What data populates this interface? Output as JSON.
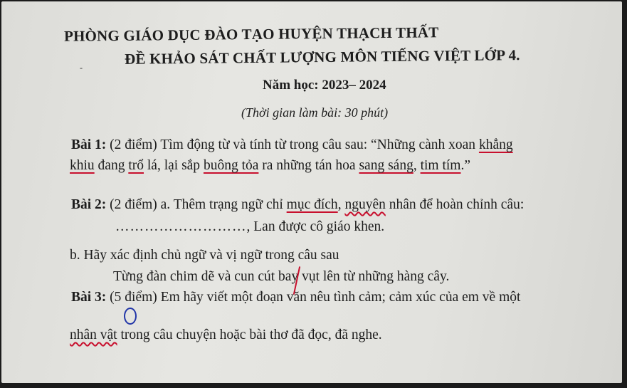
{
  "header": {
    "office": "PHÒNG GIÁO DỤC ĐÀO TẠO HUYỆN THẠCH THẤT",
    "exam_title": "ĐỀ KHẢO SÁT CHẤT LƯỢNG MÔN TIẾNG VIỆT LỚP 4.",
    "school_year": "Năm học: 2023– 2024",
    "time": "(Thời gian làm bài: 30 phút)"
  },
  "bai1": {
    "label": "Bài 1:",
    "points": "(2 điểm)",
    "prompt": "Tìm động từ và  tính từ trong câu sau: “Những cành xoan ",
    "w_khang": "khẳng",
    "w_khiu": "khiu",
    "t1": " đang ",
    "w_tro": "trổ",
    "t2": " lá, lại sắp ",
    "w_buong": "buông tỏa",
    "t3": " ra những tán hoa ",
    "w_sang": "sang sáng",
    "t4": ", ",
    "w_tim": "tim tím",
    "t5": ".”"
  },
  "bai2": {
    "label": "Bài 2:",
    "a_pre": "(2 điểm) a. Thêm trạng ngữ chỉ ",
    "w_mucdich": "mục đích",
    "a_mid": ", ",
    "w_nguyen": "nguyên",
    "a_post": " nhân để hoàn chỉnh câu:",
    "blank": "………………………",
    "a_sentence": ", Lan được cô giáo khen.",
    "b_prompt": "b. Hãy xác định chủ ngữ và vị ngữ trong câu sau",
    "b_sentence_subject": "Từng đàn chim dẽ và cun cút",
    "b_sentence_predicate": "bay vụt lên từ những hàng cây."
  },
  "bai3": {
    "label": "Bài 3:",
    "points_open": "(",
    "points_num": "5",
    "points_rest": " điểm) Em hãy viết một đoạn văn nêu tình cảm; cảm xúc của em về một",
    "w_nhanvat": "nhân vật",
    "line2": " trong câu chuyện hoặc bài thơ đã đọc, đã nghe."
  },
  "colors": {
    "paper": "#e2e2de",
    "ink": "#1d1d1d",
    "red_pen": "#c8102e",
    "blue_pen": "#2236a8"
  }
}
